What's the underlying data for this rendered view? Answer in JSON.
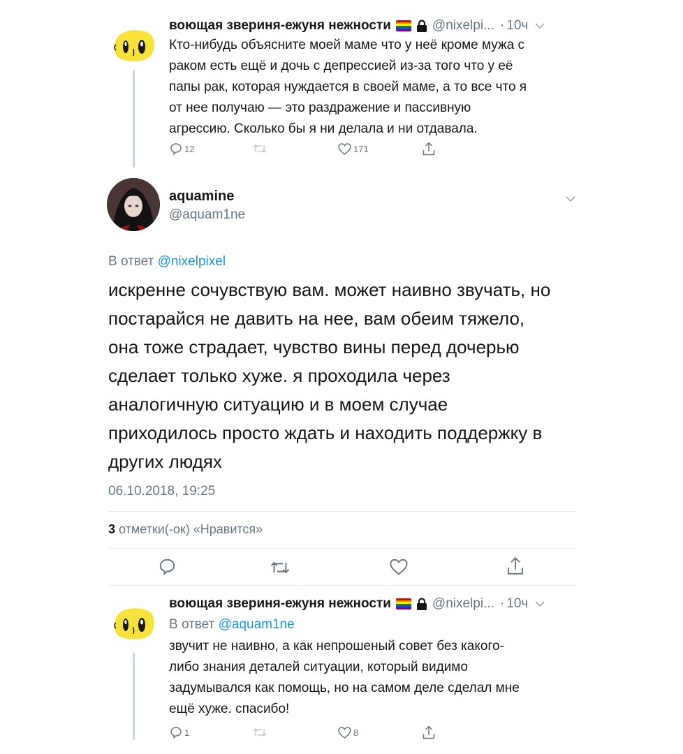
{
  "tweet1": {
    "display_name": "воющая звериня-ежуня нежности",
    "handle": "@nixelpi...",
    "separator": "·",
    "time": "10ч",
    "text_lines": [
      "Кто-нибудь объясните моей маме что у неё кроме мужа с",
      "раком есть ещё и дочь с депрессией из-за того что у её",
      "папы рак, которая нуждается в своей маме, а то все что я",
      "от нее получаю — это раздражение и пассивную",
      "агрессию. Сколько бы я ни делала и ни отдавала."
    ],
    "replies": "12",
    "retweets": "",
    "likes": "171"
  },
  "main_tweet": {
    "display_name": "aquamine",
    "handle": "@aquam1ne",
    "reply_prefix": "В ответ",
    "reply_mention": "@nixelpixel",
    "text_lines": [
      "искренне сочувствую вам. может наивно звучать, но",
      "постарайся не давить на нее, вам обеим тяжело,",
      "она тоже страдает, чувство вины перед дочерью",
      "сделает только хуже. я проходила через",
      "аналогичную ситуацию и в моем случае",
      "приходилось просто ждать и находить поддержку в",
      "других людях"
    ],
    "timestamp": "06.10.2018, 19:25",
    "likes_count": "3",
    "likes_label": "отметки(-ок) «Нравится»"
  },
  "tweet3": {
    "display_name": "воющая звериня-ежуня нежности",
    "handle": "@nixelpi...",
    "separator": "·",
    "time": "10ч",
    "reply_prefix": "В ответ",
    "reply_mention": "@aquam1ne",
    "text_lines": [
      "звучит не наивно, а как непрошеный совет без какого-",
      "либо знания деталей ситуации, который видимо",
      "задумывался как помощь, но на самом деле сделал мне",
      "ещё хуже. спасибо!"
    ],
    "replies": "1",
    "retweets": "",
    "likes": "8"
  },
  "icons": {
    "reply": "reply-icon",
    "retweet": "retweet-icon",
    "like": "heart-icon",
    "share": "share-icon",
    "more": "chevron-down-icon",
    "lock": "lock-icon",
    "flag": "rainbow-flag-icon"
  },
  "colors": {
    "text": "#14171a",
    "secondary": "#657786",
    "link": "#1b95e0",
    "thread_line": "#cbd5dc",
    "blob_yellow": "#f7e23a"
  }
}
